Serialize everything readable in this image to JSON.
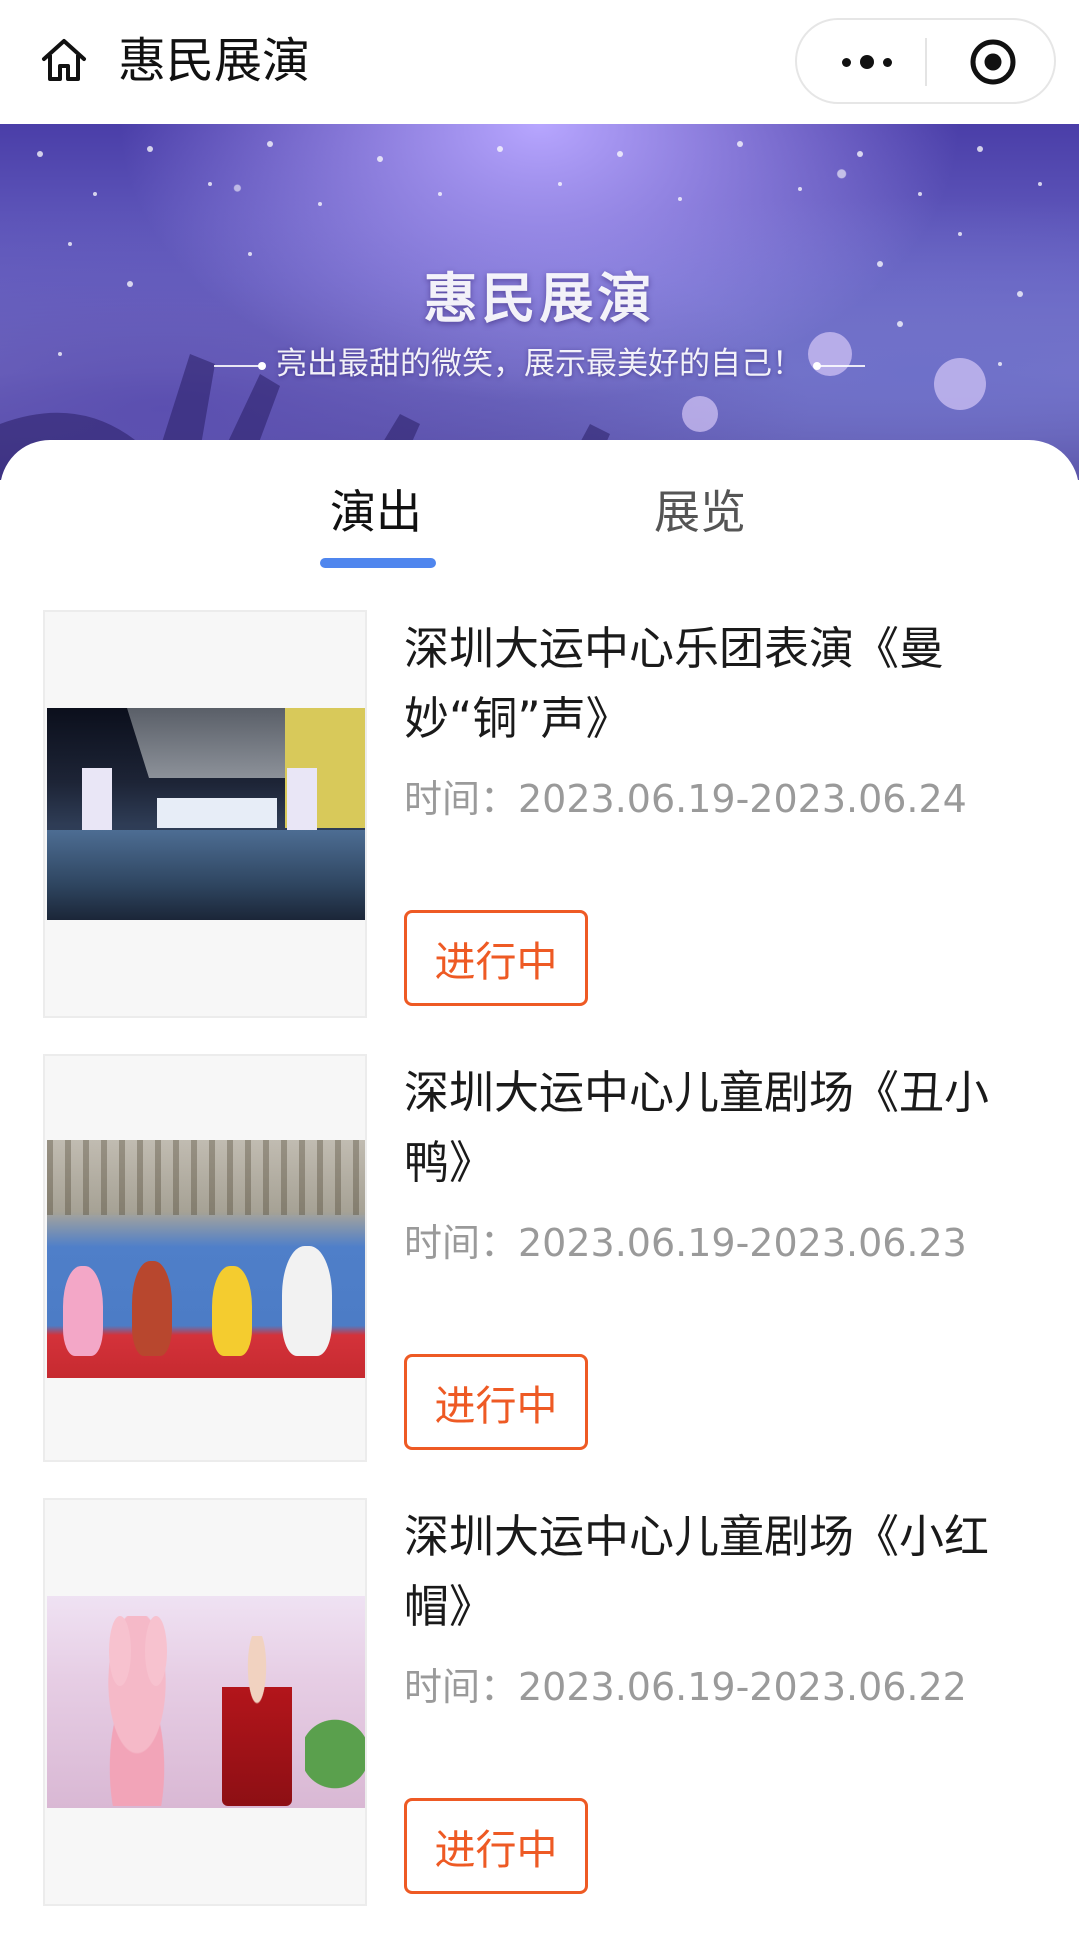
{
  "header": {
    "title": "惠民展演",
    "home_icon": "home-icon",
    "more_icon": "more-dots-icon",
    "close_icon": "target-close-icon"
  },
  "banner": {
    "title": "惠民展演",
    "subtitle": "亮出最甜的微笑，展示最美好的自己！",
    "colors": {
      "primary": "#4a3ea8",
      "secondary": "#7f7acb"
    }
  },
  "tabs": [
    {
      "label": "演出",
      "active": true
    },
    {
      "label": "展览",
      "active": false
    }
  ],
  "accent_color": "#4f86ee",
  "status_color": "#ee5a24",
  "events": [
    {
      "title": "深圳大运中心乐团表演《曼妙“铜”声》",
      "time": "时间：2023.06.19-2023.06.24",
      "status": "进行中"
    },
    {
      "title": "深圳大运中心儿童剧场《丑小鸭》",
      "time": "时间：2023.06.19-2023.06.23",
      "status": "进行中"
    },
    {
      "title": "深圳大运中心儿童剧场《小红帽》",
      "time": "时间：2023.06.19-2023.06.22",
      "status": "进行中"
    }
  ]
}
